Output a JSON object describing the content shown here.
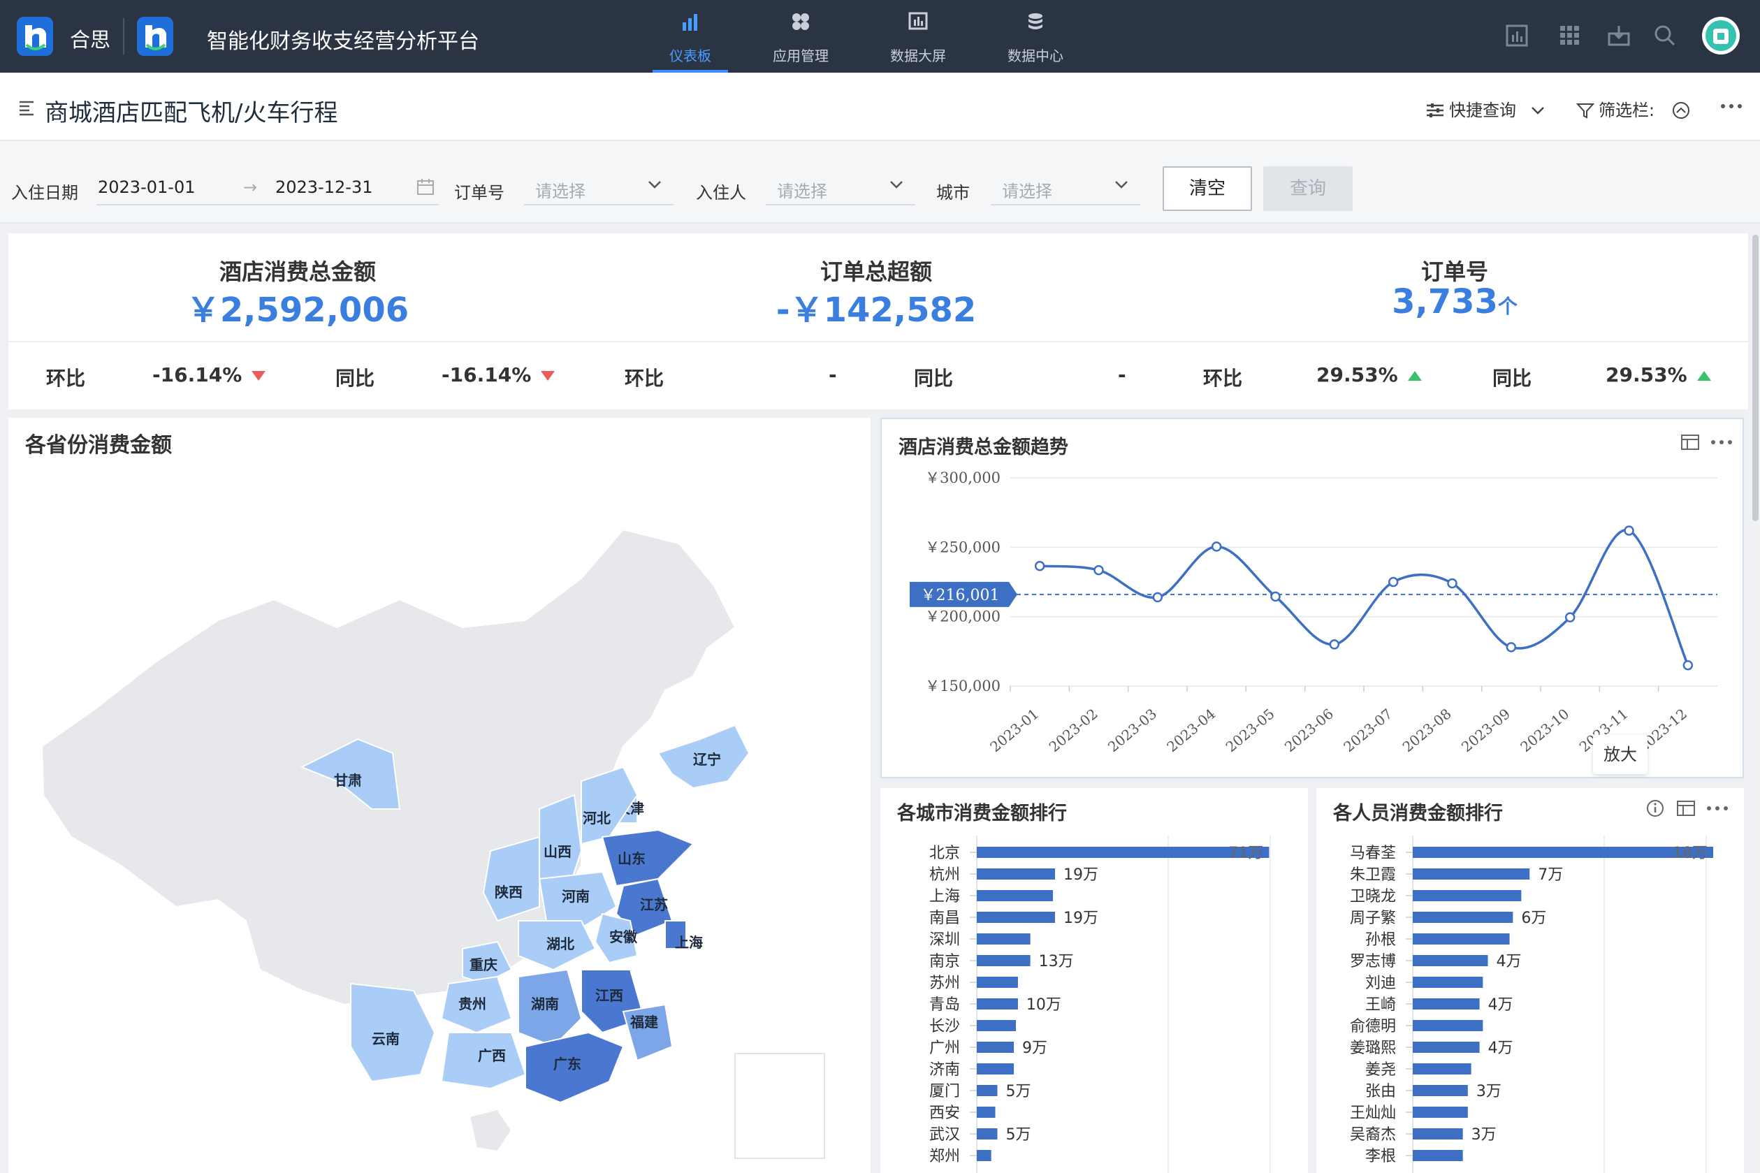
{
  "header": {
    "brand": "合思",
    "app_title": "智能化财务收支经营分析平台",
    "tabs": [
      {
        "label": "仪表板",
        "icon": "bar-chart-icon",
        "active": true
      },
      {
        "label": "应用管理",
        "icon": "app-grid-icon",
        "active": false
      },
      {
        "label": "数据大屏",
        "icon": "screen-chart-icon",
        "active": false
      },
      {
        "label": "数据中心",
        "icon": "database-icon",
        "active": false
      }
    ],
    "colors": {
      "bg": "#2b3443",
      "active": "#3a8cff"
    }
  },
  "page": {
    "title": "商城酒店匹配飞机/火车行程",
    "quick_query": "快捷查询",
    "filter_bar_label": "筛选栏:"
  },
  "filters": {
    "date_label": "入住日期",
    "date_from": "2023-01-01",
    "date_sep": "→",
    "date_to": "2023-12-31",
    "order_label": "订单号",
    "order_placeholder": "请选择",
    "guest_label": "入住人",
    "guest_placeholder": "请选择",
    "city_label": "城市",
    "city_placeholder": "请选择",
    "clear_button": "清空",
    "query_button": "查询"
  },
  "kpis": [
    {
      "title": "酒店消费总金额",
      "value": "￥2,592,006",
      "mom_label": "环比",
      "mom": "-16.14%",
      "mom_trend": "down",
      "yoy_label": "同比",
      "yoy": "-16.14%",
      "yoy_trend": "down"
    },
    {
      "title": "订单总超额",
      "value": "-￥142,582",
      "mom_label": "环比",
      "mom": "-",
      "mom_trend": "none",
      "yoy_label": "同比",
      "yoy": "-",
      "yoy_trend": "none"
    },
    {
      "title": "订单号",
      "value": "3,733",
      "unit": "个",
      "mom_label": "环比",
      "mom": "29.53%",
      "mom_trend": "up",
      "yoy_label": "同比",
      "yoy": "29.53%",
      "yoy_trend": "up"
    }
  ],
  "map_card": {
    "title": "各省份消费金额",
    "provinces": [
      {
        "name": "辽宁",
        "level": 1
      },
      {
        "name": "天津",
        "level": 1
      },
      {
        "name": "河北",
        "level": 1
      },
      {
        "name": "山西",
        "level": 1
      },
      {
        "name": "甘肃",
        "level": 1
      },
      {
        "name": "山东",
        "level": 3
      },
      {
        "name": "陕西",
        "level": 1
      },
      {
        "name": "河南",
        "level": 1
      },
      {
        "name": "江苏",
        "level": 3
      },
      {
        "name": "安徽",
        "level": 1
      },
      {
        "name": "湖北",
        "level": 1
      },
      {
        "name": "上海",
        "level": 3
      },
      {
        "name": "重庆",
        "level": 1
      },
      {
        "name": "贵州",
        "level": 1
      },
      {
        "name": "湖南",
        "level": 2
      },
      {
        "name": "江西",
        "level": 3
      },
      {
        "name": "福建",
        "level": 2
      },
      {
        "name": "云南",
        "level": 1
      },
      {
        "name": "广西",
        "level": 1
      },
      {
        "name": "广东",
        "level": 3
      }
    ],
    "colors": {
      "level0": "#e6e8eb",
      "level1": "#a9cdf6",
      "level2": "#7ca6e8",
      "level3": "#4a77d0"
    }
  },
  "trend_card": {
    "title": "酒店消费总金额趋势",
    "tooltip": "放大"
  },
  "city_card": {
    "title": "各城市消费金额排行"
  },
  "person_card": {
    "title": "各人员消费金额排行"
  },
  "chart_data": [
    {
      "type": "line",
      "title": "酒店消费总金额趋势",
      "x": [
        "2023-01",
        "2023-02",
        "2023-03",
        "2023-04",
        "2023-05",
        "2023-06",
        "2023-07",
        "2023-08",
        "2023-09",
        "2023-10",
        "2023-11",
        "2023-12"
      ],
      "series": [
        {
          "values": [
            236500,
            233500,
            214000,
            250500,
            214500,
            180000,
            225000,
            224000,
            178000,
            199500,
            262000,
            165000
          ]
        }
      ],
      "average_line": {
        "value": 216001,
        "label": "￥216,001"
      },
      "yticks": [
        "￥300,000",
        "￥250,000",
        "￥200,000",
        "￥150,000"
      ],
      "ylim": [
        150000,
        300000
      ],
      "grid": true,
      "color": "#3d6fc4"
    },
    {
      "type": "bar",
      "orientation": "horizontal",
      "title": "各城市消费金额排行",
      "categories": [
        "北京",
        "杭州",
        "上海",
        "南昌",
        "深圳",
        "南京",
        "苏州",
        "青岛",
        "长沙",
        "广州",
        "济南",
        "厦门",
        "西安",
        "武汉",
        "郑州"
      ],
      "values": [
        710000,
        190000,
        185000,
        190000,
        130000,
        130000,
        100000,
        100000,
        95000,
        90000,
        90000,
        50000,
        45000,
        50000,
        35000
      ],
      "labels": [
        "71万",
        "19万",
        "",
        "19万",
        "",
        "13万",
        "",
        "10万",
        "",
        "9万",
        "",
        "5万",
        "",
        "5万",
        ""
      ],
      "xlim": [
        0,
        750000
      ],
      "color": "#3d6fc4"
    },
    {
      "type": "bar",
      "orientation": "horizontal",
      "title": "各人员消费金额排行",
      "categories": [
        "马春荃",
        "朱卫霞",
        "卫晓龙",
        "周子繁",
        "孙根",
        "罗志博",
        "刘迪",
        "王崎",
        "俞德明",
        "姜璐熙",
        "姜尧",
        "张由",
        "王灿灿",
        "吴裔杰",
        "李根"
      ],
      "values": [
        180000,
        70000,
        65000,
        60000,
        58000,
        45000,
        42000,
        40000,
        42000,
        40000,
        35000,
        33000,
        33000,
        30000,
        30000
      ],
      "labels": [
        "18万",
        "7万",
        "",
        "6万",
        "",
        "4万",
        "",
        "4万",
        "",
        "4万",
        "",
        "3万",
        "",
        "3万",
        ""
      ],
      "xlim": [
        0,
        185000
      ],
      "color": "#3d6fc4"
    }
  ]
}
